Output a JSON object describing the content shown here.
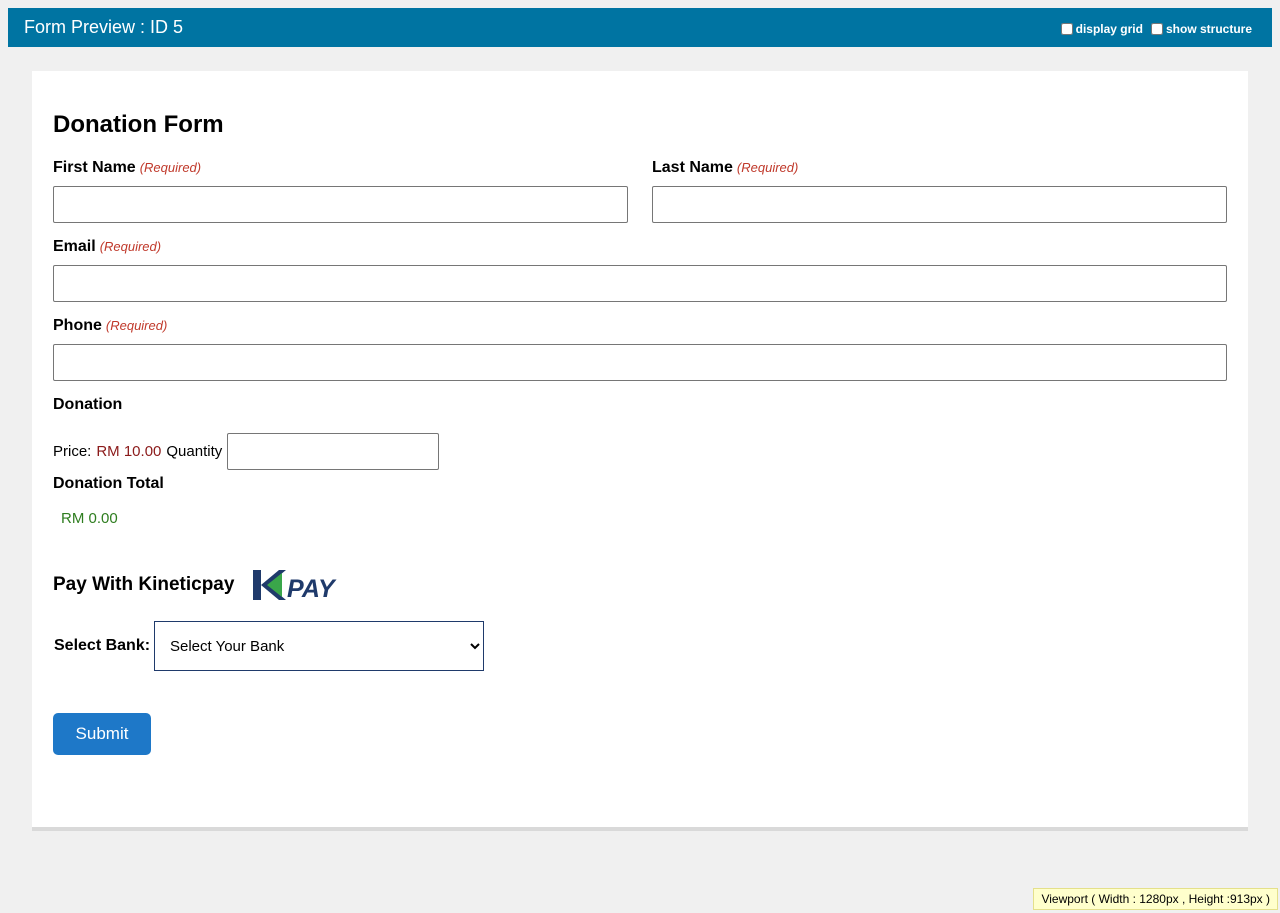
{
  "header": {
    "title": "Form Preview : ID 5",
    "options": [
      {
        "label": "display grid",
        "checked": false
      },
      {
        "label": "show structure",
        "checked": false
      }
    ]
  },
  "form": {
    "title": "Donation Form",
    "required_text": "(Required)",
    "first_name": {
      "label": "First Name",
      "value": ""
    },
    "last_name": {
      "label": "Last Name",
      "value": ""
    },
    "email": {
      "label": "Email",
      "value": ""
    },
    "phone": {
      "label": "Phone",
      "value": ""
    },
    "donation": {
      "label": "Donation",
      "price_label": "Price:",
      "price_value": "RM 10.00",
      "quantity_label": "Quantity",
      "quantity_value": ""
    },
    "total": {
      "label": "Donation Total",
      "value": "RM 0.00"
    },
    "payment": {
      "title": "Pay With Kineticpay",
      "logo_text": "PAY",
      "bank_label": "Select Bank:",
      "bank_selected": "Select Your Bank",
      "bank_options": [
        "Select Your Bank"
      ]
    },
    "submit_label": "Submit"
  },
  "viewport_text": "Viewport ( Width : 1280px , Height :913px )",
  "colors": {
    "header_bg": "#0074a2",
    "required": "#c0392b",
    "price": "#8b1a1a",
    "total": "#2e7d1f",
    "submit_bg": "#1e78c8",
    "logo_blue": "#1f3a6b",
    "logo_green": "#3aa64a"
  }
}
